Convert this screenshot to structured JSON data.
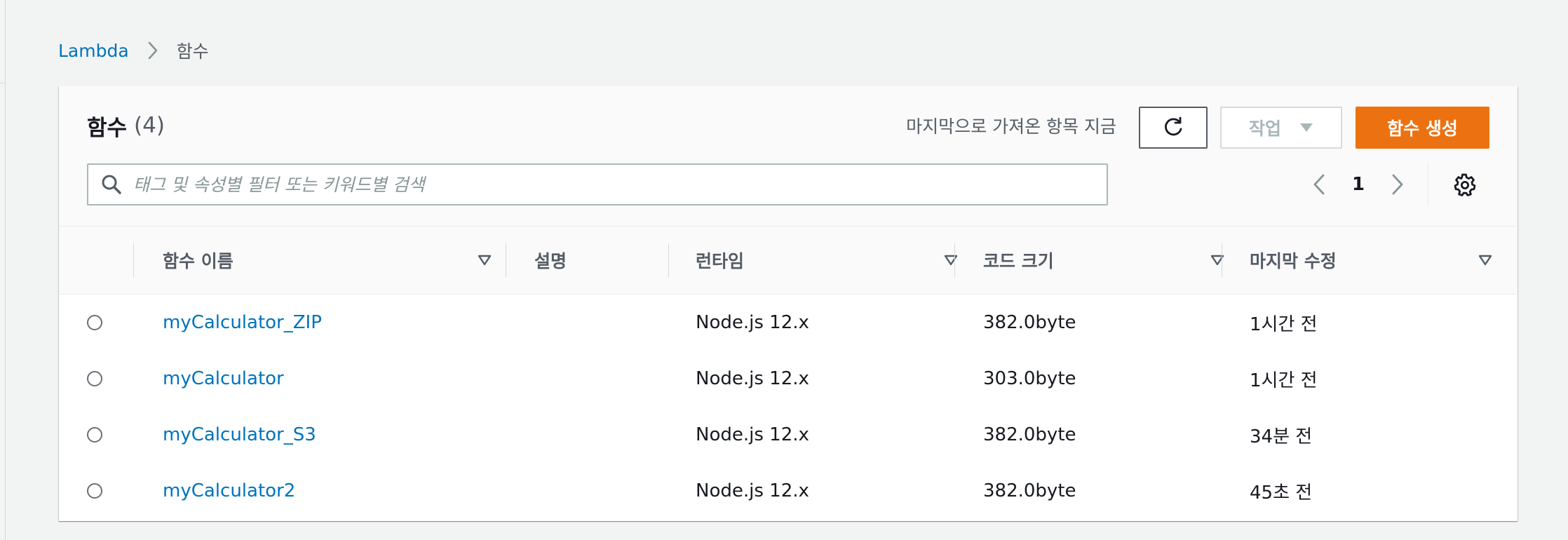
{
  "breadcrumb": {
    "root": "Lambda",
    "current": "함수"
  },
  "panel": {
    "title": "함수",
    "count": "(4)",
    "last_fetched": "마지막으로 가져온 항목 지금",
    "actions_label": "작업",
    "create_label": "함수 생성"
  },
  "search": {
    "placeholder": "태그 및 속성별 필터 또는 키워드별 검색",
    "value": ""
  },
  "pagination": {
    "current_page": "1"
  },
  "table": {
    "columns": {
      "name": "함수 이름",
      "description": "설명",
      "runtime": "런타임",
      "code_size": "코드 크기",
      "last_modified": "마지막 수정"
    },
    "rows": [
      {
        "name": "myCalculator_ZIP",
        "description": "",
        "runtime": "Node.js 12.x",
        "code_size": "382.0byte",
        "last_modified": "1시간 전"
      },
      {
        "name": "myCalculator",
        "description": "",
        "runtime": "Node.js 12.x",
        "code_size": "303.0byte",
        "last_modified": "1시간 전"
      },
      {
        "name": "myCalculator_S3",
        "description": "",
        "runtime": "Node.js 12.x",
        "code_size": "382.0byte",
        "last_modified": "34분 전"
      },
      {
        "name": "myCalculator2",
        "description": "",
        "runtime": "Node.js 12.x",
        "code_size": "382.0byte",
        "last_modified": "45초 전"
      }
    ]
  },
  "icons": {
    "breadcrumb_separator": "chevron-right-icon",
    "refresh": "refresh-icon",
    "actions_caret": "caret-down-icon",
    "search": "search-icon",
    "prev": "chevron-left-icon",
    "next": "chevron-right-icon",
    "settings": "gear-icon",
    "sort": "sort-caret-icon"
  },
  "colors": {
    "link": "#0073bb",
    "primary_button": "#ec7211",
    "background": "#f2f3f3",
    "text": "#16191f",
    "muted_text": "#545b64"
  }
}
